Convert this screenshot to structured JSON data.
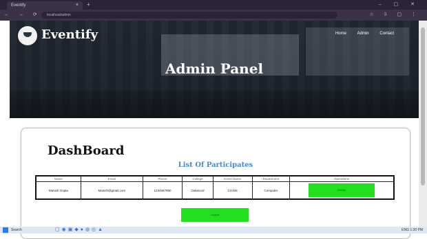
{
  "browser": {
    "tab_title": "Eventify",
    "tab_close": "×",
    "new_tab": "+",
    "window_controls": "– ▢ ✕",
    "nav_buttons": "← → ⟳",
    "url": "localhost/admin",
    "toolbar_icons": "☆ ⇩ ▢ ⋮"
  },
  "header": {
    "brand": "Eventify",
    "nav": [
      "Home",
      "Admin",
      "Contact"
    ],
    "title": "Admin Panel"
  },
  "dashboard": {
    "title": "DashBoard",
    "list_title": "List Of Participates",
    "columns": [
      "Name",
      "Email",
      "Phone",
      "College",
      "Event Name",
      "Department",
      "Operations"
    ],
    "rows": [
      {
        "name": "Manish Gupta",
        "email": "Manish@gmail.com",
        "phone": "1234567890",
        "college": "Oakwood",
        "event": "Cricket",
        "department": "Computer",
        "operation": "Delete"
      }
    ],
    "bottom_button": "Logout"
  },
  "taskbar": {
    "search": "Search",
    "apps": "▢◉▣◆●◍◎▲",
    "tray": "ENG 1:30 PM"
  },
  "colors": {
    "accent_green": "#22e01f",
    "title_blue": "#4b88c7",
    "chrome_bg": "#3b3247"
  }
}
